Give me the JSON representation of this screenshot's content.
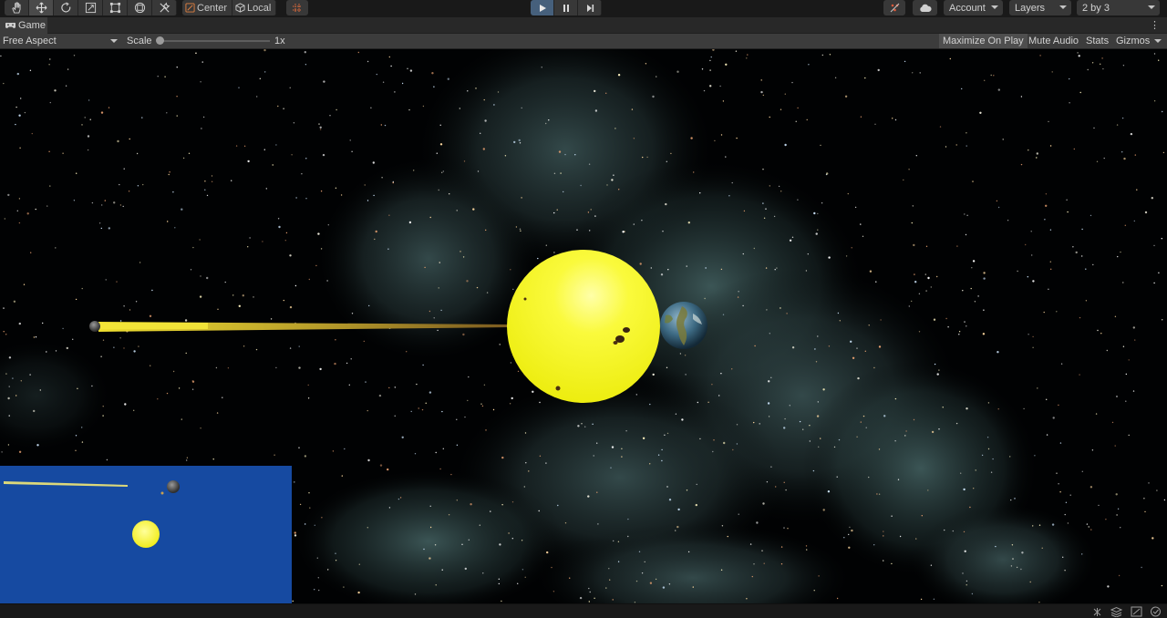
{
  "toolbar": {
    "tools": [
      "hand-tool",
      "move-tool",
      "rotate-tool",
      "scale-tool",
      "rect-tool",
      "transform-tool",
      "custom-tool"
    ],
    "pivot_mode": "Center",
    "pivot_rotation": "Local",
    "account_label": "Account",
    "layers_label": "Layers",
    "layout_label": "2 by 3"
  },
  "tab": {
    "title": "Game"
  },
  "gamebar": {
    "aspect": "Free Aspect",
    "scale_label": "Scale",
    "scale_value": "1x",
    "maximize_on_play": "Maximize On Play",
    "mute_audio": "Mute Audio",
    "stats": "Stats",
    "gizmos": "Gizmos"
  },
  "colors": {
    "sun": "#fafa3c",
    "minimap_bg": "#164aa1",
    "play_active": "#46607c",
    "laser": "#e8d640"
  },
  "playback": {
    "playing": true
  }
}
